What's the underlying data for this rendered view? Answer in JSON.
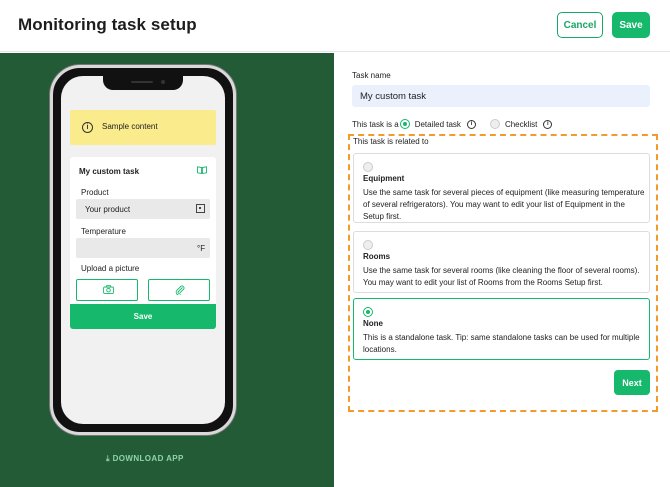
{
  "header": {
    "title": "Monitoring task setup",
    "cancel_label": "Cancel",
    "save_label": "Save"
  },
  "preview": {
    "sample_label": "Sample content",
    "card_title": "My custom task",
    "product_label": "Product",
    "product_value": "Your product",
    "temperature_label": "Temperature",
    "temperature_unit": "°F",
    "upload_label": "Upload a picture",
    "save_label": "Save",
    "download_label": "DOWNLOAD APP"
  },
  "form": {
    "task_name_label": "Task name",
    "task_name_value": "My custom task",
    "task_type_prefix": "This task is a",
    "task_types": [
      "Detailed task",
      "Checklist"
    ],
    "selected_task_type": "Detailed task",
    "related_label": "This task is related to",
    "options": [
      {
        "name": "Equipment",
        "description": "Use the same task for several pieces of equipment (like measuring temperature of several refrigerators). You may want to edit your list of Equipment in the Setup first.",
        "selected": false
      },
      {
        "name": "Rooms",
        "description": "Use the same task for several rooms (like cleaning the floor of several rooms). You may want to edit your list of Rooms from the Rooms Setup first.",
        "selected": false
      },
      {
        "name": "None",
        "description": "This is a standalone task. Tip: same standalone tasks can be used for multiple locations.",
        "selected": true
      }
    ],
    "next_label": "Next"
  },
  "colors": {
    "brand_green": "#16b86c",
    "panel_green": "#235b37",
    "highlight_orange": "#f39a2c",
    "sample_yellow": "#faeb8d"
  }
}
